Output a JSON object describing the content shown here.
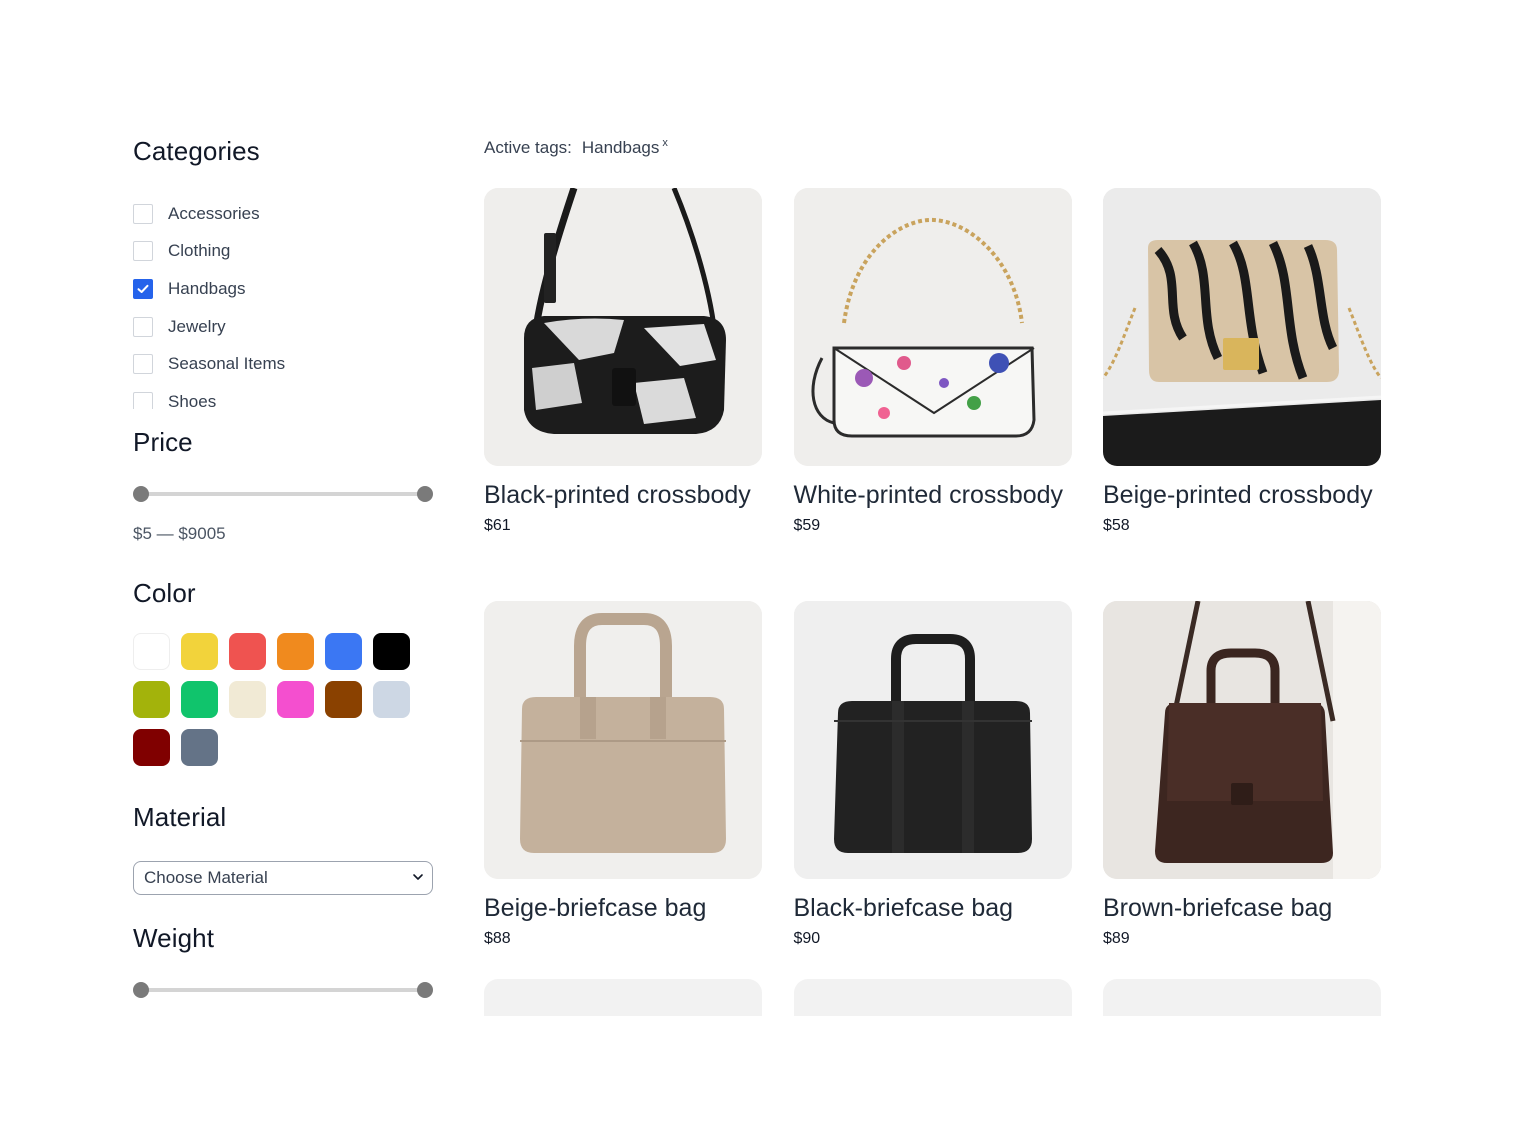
{
  "sidebar": {
    "categories": {
      "title": "Categories",
      "items": [
        {
          "label": "Accessories",
          "checked": false
        },
        {
          "label": "Clothing",
          "checked": false
        },
        {
          "label": "Handbags",
          "checked": true
        },
        {
          "label": "Jewelry",
          "checked": false
        },
        {
          "label": "Seasonal Items",
          "checked": false
        },
        {
          "label": "Shoes",
          "checked": false
        }
      ]
    },
    "price": {
      "title": "Price",
      "range_text": "$5 — $9005",
      "min_fraction": 0,
      "max_fraction": 1
    },
    "color": {
      "title": "Color",
      "swatches": [
        "#ffffff",
        "#f2d33b",
        "#ef5350",
        "#f08a1e",
        "#3b77f3",
        "#000000",
        "#a3b30b",
        "#10c46c",
        "#f1ead5",
        "#f44fcf",
        "#8a4100",
        "#cdd7e4",
        "#800000",
        "#647387"
      ]
    },
    "material": {
      "title": "Material",
      "selected": "Choose Material"
    },
    "weight": {
      "title": "Weight",
      "min_fraction": 0,
      "max_fraction": 1
    }
  },
  "main": {
    "active_tags_label": "Active tags:",
    "tags": [
      {
        "label": "Handbags",
        "remove": "x"
      }
    ],
    "products": [
      {
        "name": "Black-printed crossbody",
        "price": "$61",
        "image": "black-white-print-crossbody"
      },
      {
        "name": "White-printed crossbody",
        "price": "$59",
        "image": "floral-white-crossbody"
      },
      {
        "name": "Beige-printed crossbody",
        "price": "$58",
        "image": "zebra-print-crossbody"
      },
      {
        "name": "Beige-briefcase bag",
        "price": "$88",
        "image": "beige-briefcase"
      },
      {
        "name": "Black-briefcase bag",
        "price": "$90",
        "image": "black-briefcase"
      },
      {
        "name": "Brown-briefcase bag",
        "price": "$89",
        "image": "brown-briefcase"
      }
    ]
  }
}
